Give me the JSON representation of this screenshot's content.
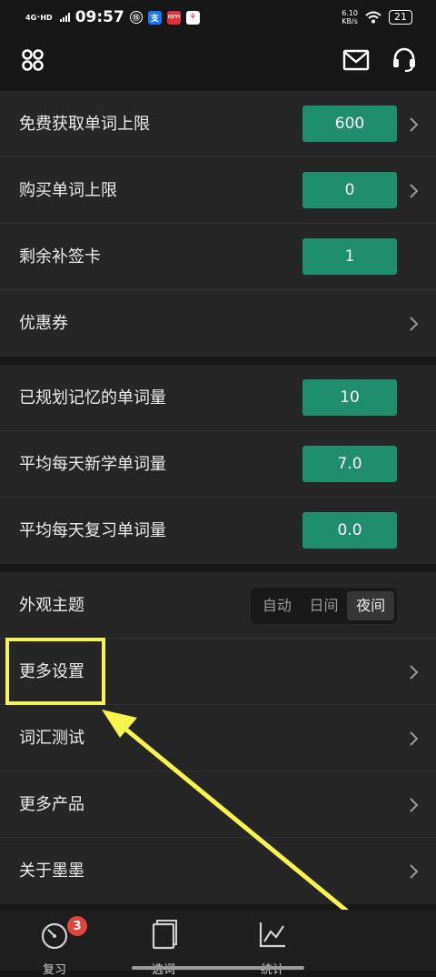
{
  "status_bar": {
    "network": "4G⁺HD",
    "time": "09:57",
    "app_icons": [
      "⑮",
      "支",
      "iQIYI",
      "⚘"
    ],
    "speed_value": "6.10",
    "speed_unit": "KB/s",
    "battery": "21"
  },
  "header": {
    "left_icon": "grid-menu-icon",
    "right_icons": [
      "mail-icon",
      "headset-icon"
    ]
  },
  "section1": [
    {
      "label": "免费获取单词上限",
      "value": "600",
      "chevron": true
    },
    {
      "label": "购买单词上限",
      "value": "0",
      "chevron": true
    },
    {
      "label": "剩余补签卡",
      "value": "1",
      "chevron": false
    },
    {
      "label": "优惠券",
      "value": null,
      "chevron": true
    }
  ],
  "section2": [
    {
      "label": "已规划记忆的单词量",
      "value": "10"
    },
    {
      "label": "平均每天新学单词量",
      "value": "7.0"
    },
    {
      "label": "平均每天复习单词量",
      "value": "0.0"
    }
  ],
  "section3": {
    "theme_label": "外观主题",
    "theme_options": [
      "自动",
      "日间",
      "夜间"
    ],
    "theme_selected": "夜间",
    "links": [
      "更多设置",
      "词汇测试",
      "更多产品",
      "关于墨墨"
    ]
  },
  "annotation_color": "#f7f54a",
  "accent_color": "#1f8e6c",
  "tab_bar": {
    "tabs": [
      {
        "label": "复习",
        "icon": "speedometer-icon",
        "badge": "3"
      },
      {
        "label": "选词",
        "icon": "cards-icon"
      },
      {
        "label": "统计",
        "icon": "line-chart-icon"
      }
    ]
  }
}
